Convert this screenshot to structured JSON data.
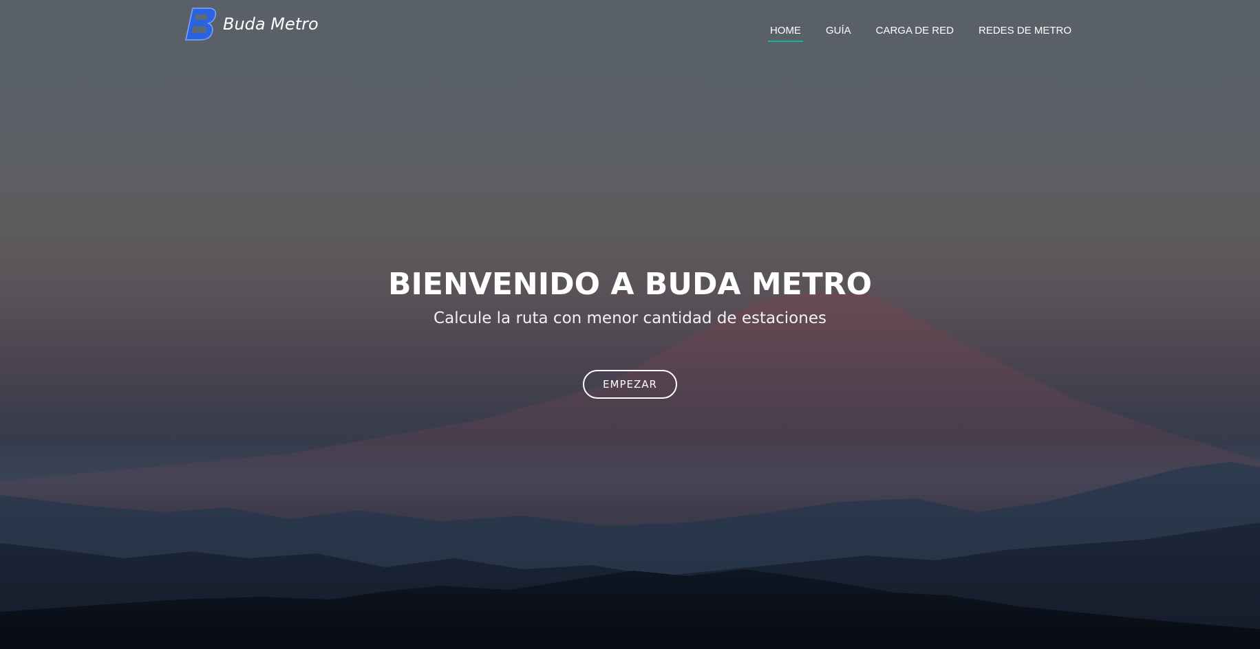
{
  "brand": {
    "logo_letter": "B",
    "name": "Buda Metro",
    "logo_color": "#2a63e0"
  },
  "nav": {
    "items": [
      {
        "label": "HOME",
        "active": true
      },
      {
        "label": "GUÍA",
        "active": false
      },
      {
        "label": "CARGA DE RED",
        "active": false
      },
      {
        "label": "REDES DE METRO",
        "active": false
      }
    ],
    "active_underline_color": "#1bb1a0"
  },
  "hero": {
    "title": "BIENVENIDO A BUDA METRO",
    "subtitle": "Calcule la ruta con menor cantidad de estaciones",
    "cta_label": "EMPEZAR",
    "background": "mountain-landscape-dusk"
  }
}
